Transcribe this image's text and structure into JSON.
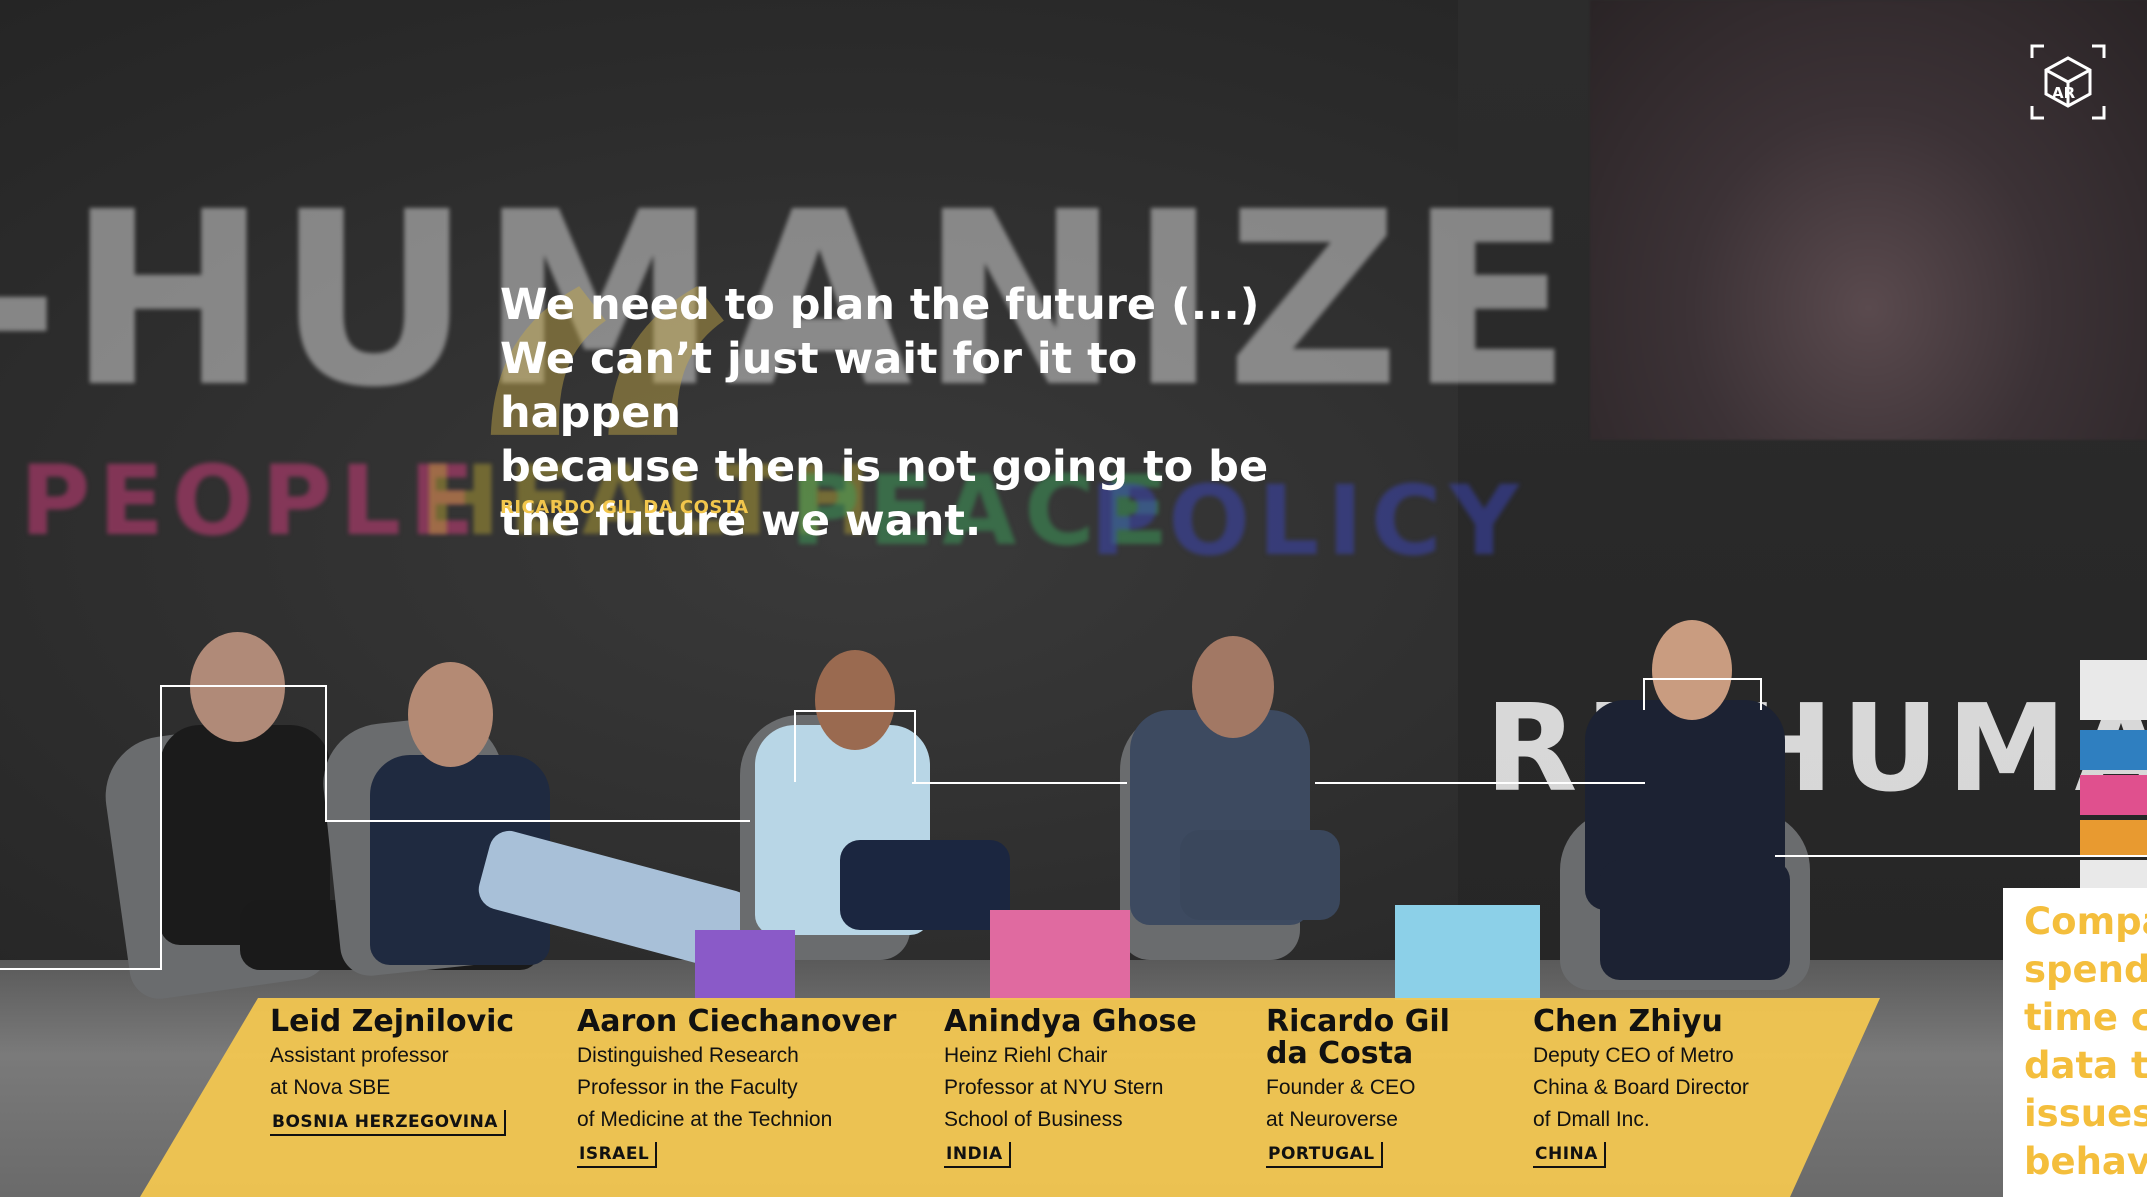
{
  "quote": {
    "text": "We need to plan the future (...)\nWe can’t just wait for it to happen\nbecause then is not going to be\nthe future we want.",
    "author": "RICARDO GIL DA COSTA",
    "mark": "“"
  },
  "background_signage": {
    "main_word": "-HUMANIZE",
    "pillars": [
      "PEOPLE",
      "HEALTH",
      "PEACE",
      "POLICY"
    ],
    "screen_logo": "RE-HUMAN"
  },
  "icons": {
    "ar": "ar-cube-icon"
  },
  "ar_label": "AR",
  "speakers": [
    {
      "name": "Leid Zejnilovic",
      "role": "Assistant professor\nat Nova SBE",
      "country": "BOSNIA HERZEGOVINA"
    },
    {
      "name": "Aaron Ciechanover",
      "role": "Distinguished Research\nProfessor in the Faculty\nof Medicine at the Technion",
      "country": "ISRAEL"
    },
    {
      "name": "Anindya Ghose",
      "role": "Heinz Riehl Chair\nProfessor at NYU Stern\nSchool of Business",
      "country": "INDIA"
    },
    {
      "name": "Ricardo Gil\nda Costa",
      "role": "Founder & CEO\nat Neuroverse",
      "country": "PORTUGAL"
    },
    {
      "name": "Chen Zhiyu",
      "role": "Deputy CEO of Metro\nChina & Board Director\nof Dmall Inc.",
      "country": "CHINA"
    }
  ],
  "side_card": {
    "text": "Compa\nspend\ntime c\ndata t\nissues\nbehav"
  },
  "colors": {
    "accent_yellow": "#F5C850",
    "quote_author": "#F2C64C",
    "side_text": "#F4BE3C"
  }
}
